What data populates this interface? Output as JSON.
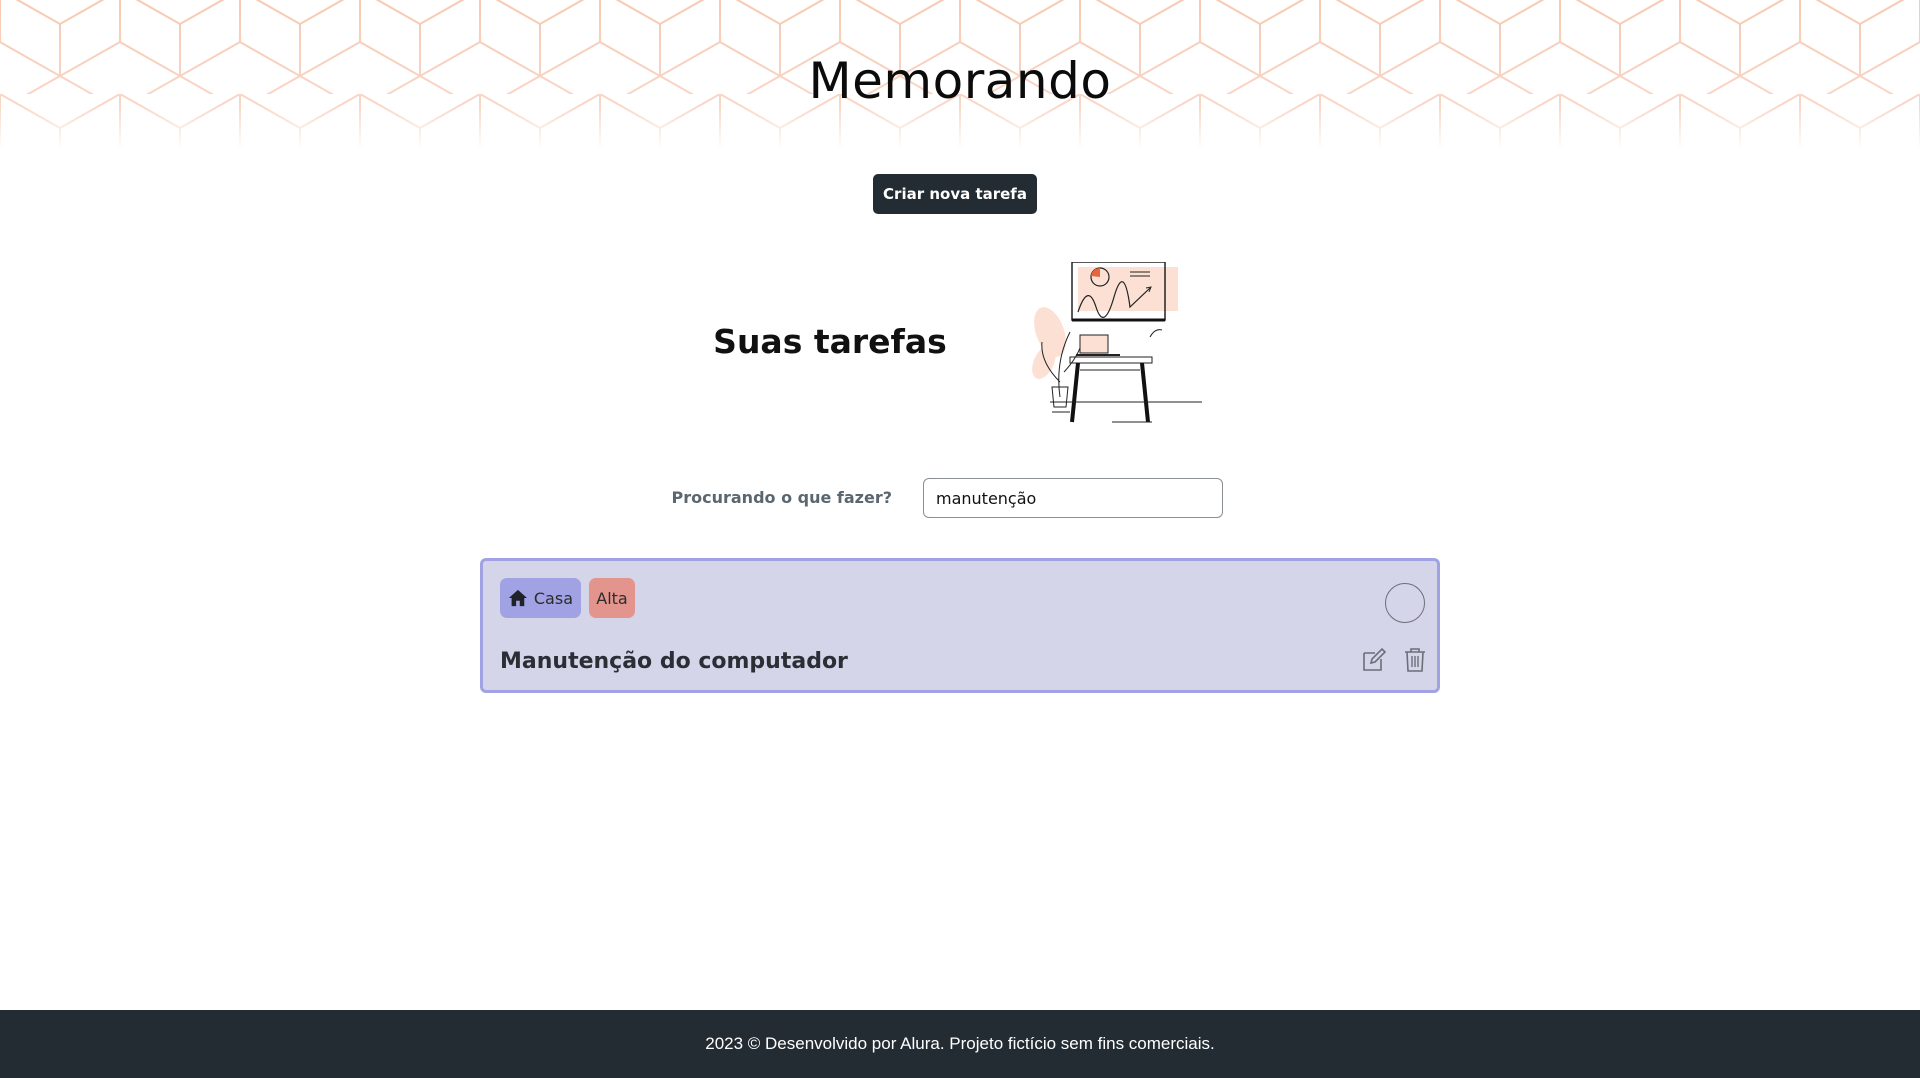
{
  "header": {
    "title": "Memorando"
  },
  "actions": {
    "create_label": "Criar nova tarefa"
  },
  "tasks_section": {
    "title": "Suas tarefas"
  },
  "search": {
    "label": "Procurando o que fazer?",
    "value": "manutenção"
  },
  "tasks": [
    {
      "title": "Manutenção do computador",
      "category": "Casa",
      "category_icon": "home-icon",
      "priority": "Alta",
      "completed": false
    }
  ],
  "footer": {
    "text": "2023 © Desenvolvido por Alura. Projeto fictício sem fins comerciais."
  },
  "colors": {
    "header_pattern": "#f7c9b2",
    "dark": "#232c33",
    "card_bg": "#d5d5e9",
    "card_border": "#a1a2e4",
    "tag_casa": "#a1a2e4",
    "tag_alta": "#e3948d",
    "illustration_accent": "#e8643c"
  }
}
